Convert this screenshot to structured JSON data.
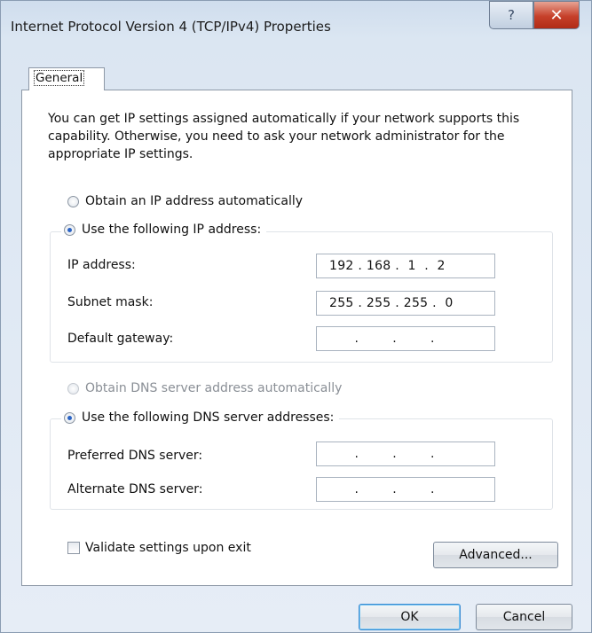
{
  "window": {
    "title": "Internet Protocol Version 4 (TCP/IPv4) Properties",
    "help_glyph": "?",
    "close_glyph": "✕"
  },
  "tabs": [
    {
      "label": "General"
    }
  ],
  "intro": "You can get IP settings assigned automatically if your network supports this capability. Otherwise, you need to ask your network administrator for the appropriate IP settings.",
  "ip": {
    "auto_label": "Obtain an IP address automatically",
    "manual_label": "Use the following IP address:",
    "selected": "manual",
    "fields": [
      {
        "label": "IP address:",
        "value": "192 . 168 .  1  .  2"
      },
      {
        "label": "Subnet mask:",
        "value": "255 . 255 . 255 .  0"
      },
      {
        "label": "Default gateway:",
        "value": "      .        .        ."
      }
    ]
  },
  "dns": {
    "auto_label": "Obtain DNS server address automatically",
    "manual_label": "Use the following DNS server addresses:",
    "selected": "manual",
    "auto_disabled": true,
    "fields": [
      {
        "label": "Preferred DNS server:",
        "value": "      .        .        ."
      },
      {
        "label": "Alternate DNS server:",
        "value": "      .        .        ."
      }
    ]
  },
  "validate": {
    "label": "Validate settings upon exit",
    "checked": false
  },
  "buttons": {
    "advanced": "Advanced...",
    "ok": "OK",
    "cancel": "Cancel"
  }
}
